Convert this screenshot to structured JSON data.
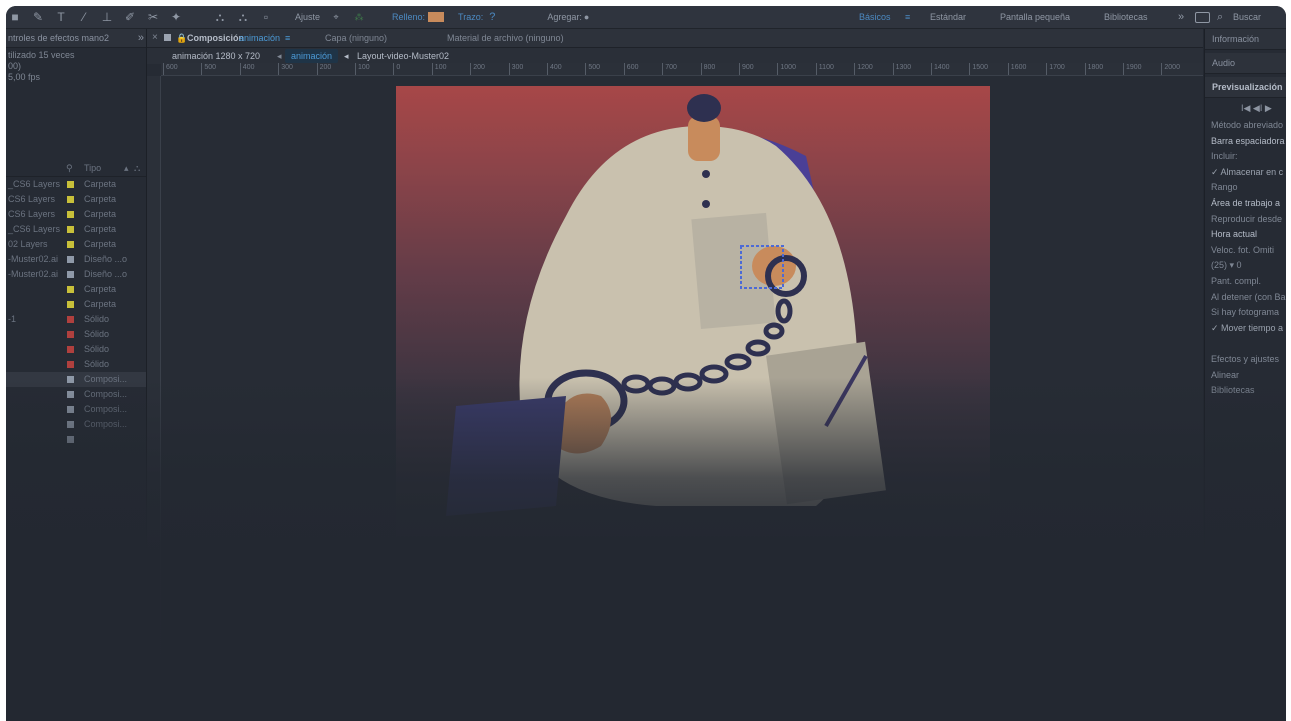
{
  "toolbar": {
    "tools": [
      "■",
      "✎",
      "T",
      "⁄",
      "⊥",
      "✐",
      "✂",
      "✦",
      "⛬",
      "⛬",
      "▫"
    ],
    "snap_label": "Ajuste",
    "fill_label": "Relleno:",
    "fill_color": "#c88b5c",
    "stroke_label": "Trazo:",
    "stroke_value": "?",
    "add_label": "Agregar:",
    "add_icon": "●",
    "workspaces": [
      "Básicos",
      "Estándar",
      "Pantalla pequeña",
      "Bibliotecas"
    ],
    "workspace_menu_icon": "≡",
    "overflow": "»",
    "search_placeholder": "Buscar",
    "search_icon": "⌕"
  },
  "left_panel": {
    "header": "ntroles de efectos mano2",
    "header_more": "»",
    "info_lines": [
      "tilizado 15 veces",
      "00)",
      "5,00 fps"
    ],
    "type_header": "Tipo",
    "rows": [
      {
        "name": "_CS6 Layers",
        "color": "#c8c03a",
        "type": "Carpeta"
      },
      {
        "name": "CS6 Layers",
        "color": "#c8c03a",
        "type": "Carpeta"
      },
      {
        "name": "CS6 Layers",
        "color": "#c8c03a",
        "type": "Carpeta"
      },
      {
        "name": "_CS6 Layers",
        "color": "#c8c03a",
        "type": "Carpeta"
      },
      {
        "name": "02 Layers",
        "color": "#c8c03a",
        "type": "Carpeta"
      },
      {
        "name": "-Muster02.ai",
        "color": "#8f99a8",
        "type": "Diseño ...o"
      },
      {
        "name": "-Muster02.ai",
        "color": "#8f99a8",
        "type": "Diseño ...o"
      },
      {
        "name": "",
        "color": "#c8c03a",
        "type": "Carpeta"
      },
      {
        "name": "",
        "color": "#c8c03a",
        "type": "Carpeta"
      },
      {
        "name": "-1",
        "color": "#b0403e",
        "type": "Sólido"
      },
      {
        "name": "",
        "color": "#b0403e",
        "type": "Sólido"
      },
      {
        "name": "",
        "color": "#b0403e",
        "type": "Sólido"
      },
      {
        "name": "",
        "color": "#b0403e",
        "type": "Sólido"
      },
      {
        "name": "",
        "color": "#8f99a8",
        "type": "Composi..."
      },
      {
        "name": "",
        "color": "#8f99a8",
        "type": "Composi..."
      },
      {
        "name": "",
        "color": "#8f99a8",
        "type": "Composi..."
      },
      {
        "name": "",
        "color": "#8f99a8",
        "type": "Composi..."
      },
      {
        "name": "",
        "color": "#8f99a8",
        "type": ""
      }
    ]
  },
  "center": {
    "tab_close": "×",
    "tab_lock": "🔒",
    "composition_label": "Composición",
    "composition_name": "animación",
    "tab_menu": "≡",
    "layer_tab": "Capa (ninguno)",
    "footage_tab": "Material de archivo (ninguno)",
    "comp_size": "animación 1280 x 720",
    "comp_tab_active": "animación",
    "comp_tab_next": "Layout-video-Muster02",
    "ruler_labels": [
      "600",
      "500",
      "400",
      "300",
      "200",
      "100",
      "0",
      "100",
      "200",
      "300",
      "400",
      "500",
      "600",
      "700",
      "800",
      "900",
      "1000",
      "1100",
      "1200",
      "1300",
      "1400",
      "1500",
      "1600",
      "1700",
      "1800",
      "1900",
      "2000"
    ]
  },
  "right_panel": {
    "headers": [
      "Información",
      "Audio",
      "Previsualización"
    ],
    "transport": "I◀  ◀I  ▶",
    "rows": [
      "Método abreviado",
      "Barra espaciadora",
      "Incluir:",
      "✓ Almacenar en c",
      "Rango",
      "Área de trabajo a",
      "Reproducir desde",
      "Hora actual",
      "Veloc. fot.   Omiti",
      "(25)    ▾    0",
      "     Pant. compl.",
      "Al detener (con Ba",
      "   Si hay fotograma",
      "✓ Mover tiempo a",
      "",
      "Efectos y ajustes",
      "Alinear",
      "Bibliotecas"
    ]
  },
  "colors": {
    "artboard_top": "#a74748",
    "skin": "#c88b5c",
    "shirt": "#c9c1ae",
    "collar": "#4a3f96",
    "chain": "#2e3050",
    "accent_blue": "#4c9ad6"
  }
}
